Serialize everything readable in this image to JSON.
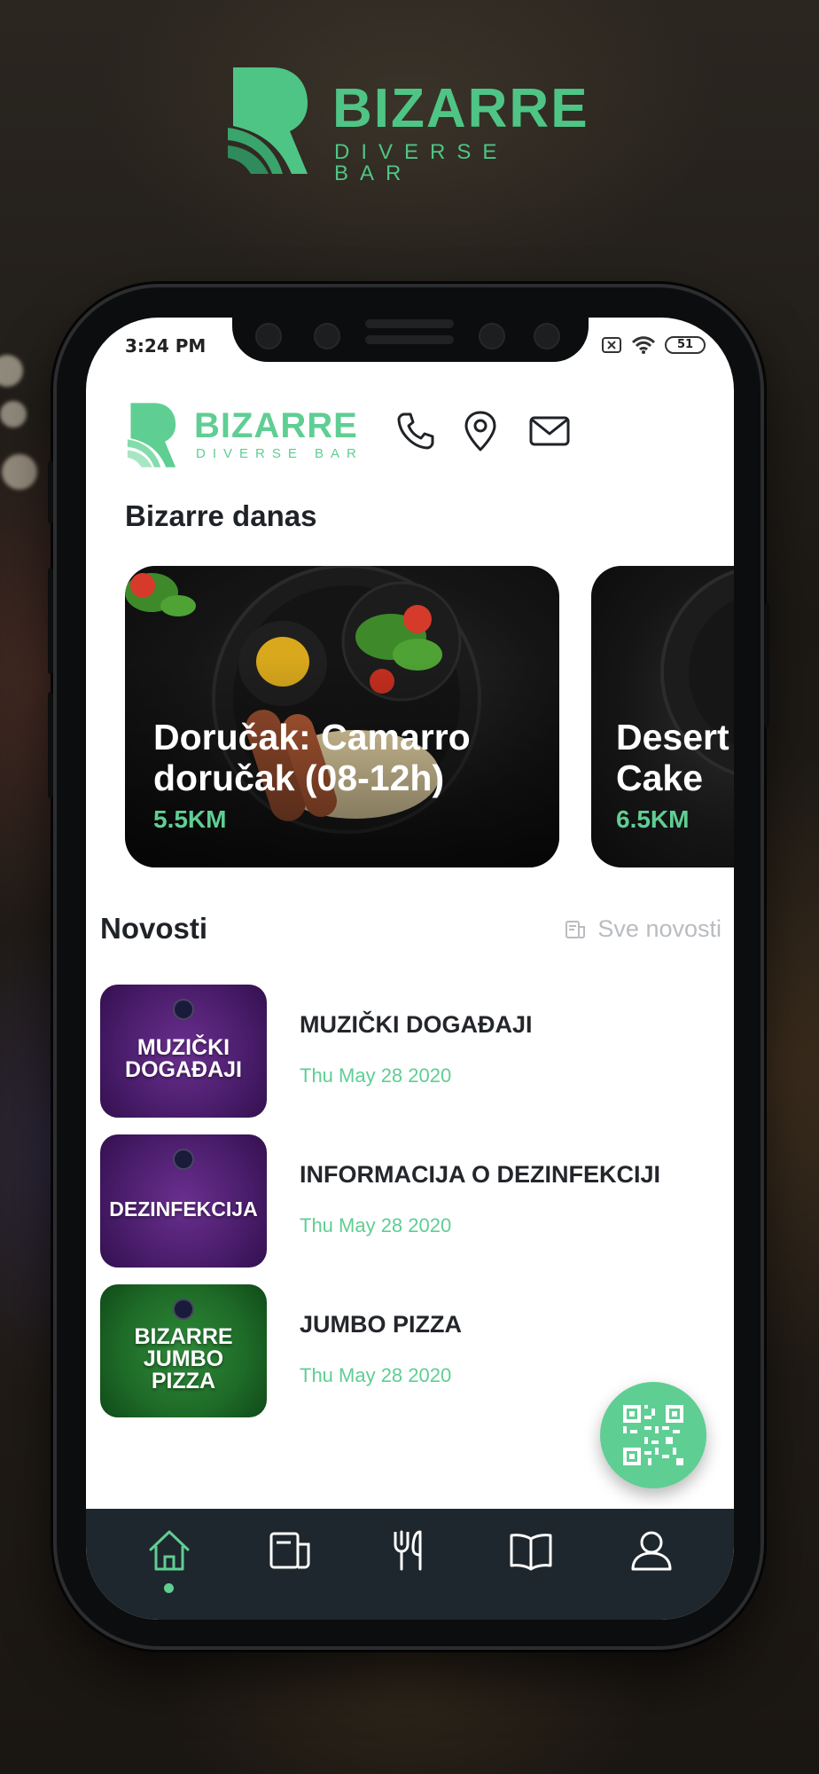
{
  "brand": {
    "name": "BIZARRE",
    "tagline": "DIVERSE BAR",
    "color": "#4fc585"
  },
  "status_bar": {
    "time": "3:24 PM",
    "battery": "51",
    "icons": [
      "sim-off-icon",
      "wifi-icon",
      "battery-icon"
    ]
  },
  "header": {
    "logo_name": "BIZARRE",
    "logo_tagline": "DIVERSE BAR",
    "icons": [
      "phone-icon",
      "location-pin-icon",
      "mail-icon"
    ]
  },
  "today": {
    "title": "Bizarre danas",
    "cards": [
      {
        "title": "Doručak: Camarro\ndoručak (08-12h)",
        "distance": "5.5KM"
      },
      {
        "title": "Desert\nCake",
        "distance": "6.5KM"
      }
    ]
  },
  "news": {
    "title": "Novosti",
    "all_label": "Sve novosti",
    "items": [
      {
        "thumb_text": "MUZIČKI\nDOGAĐAJI",
        "headline": "MUZIČKI DOGAĐAJI",
        "date": "Thu May 28 2020",
        "theme": "purple"
      },
      {
        "thumb_text": "DEZINFEKCIJA",
        "headline": "INFORMACIJA O DEZINFEKCIJI",
        "date": "Thu May 28 2020",
        "theme": "purple"
      },
      {
        "thumb_text": "BIZARRE\nJUMBO\nPIZZA",
        "headline": "JUMBO PIZZA",
        "date": "Thu May 28 2020",
        "theme": "green"
      }
    ]
  },
  "fab": {
    "icon": "qr-code-icon"
  },
  "bottom_nav": {
    "items": [
      "home-icon",
      "news-icon",
      "restaurant-icon",
      "menu-book-icon",
      "profile-icon"
    ],
    "active": "home-icon"
  },
  "colors": {
    "accent": "#5fce93",
    "nav_bg": "#1e272d",
    "text_dark": "#1f2227",
    "muted": "#b9bcc0"
  }
}
